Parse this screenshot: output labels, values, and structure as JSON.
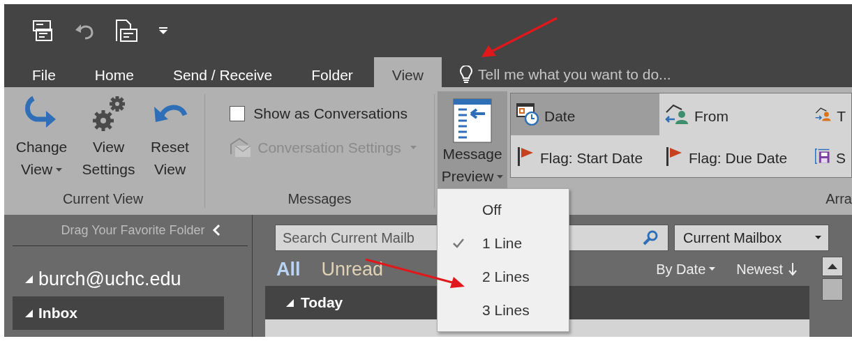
{
  "tabs": [
    {
      "label": "File",
      "selected": false
    },
    {
      "label": "Home",
      "selected": false
    },
    {
      "label": "Send / Receive",
      "selected": false
    },
    {
      "label": "Folder",
      "selected": false
    },
    {
      "label": "View",
      "selected": true
    }
  ],
  "tell_me": {
    "placeholder": "Tell me what you want to do..."
  },
  "current_view": {
    "label": "Current View",
    "buttons": [
      {
        "kind": "change",
        "label": "Change View",
        "dropdown": true
      },
      {
        "kind": "settings",
        "label": "View Settings",
        "dropdown": false
      },
      {
        "kind": "reset",
        "label": "Reset View",
        "dropdown": false
      }
    ]
  },
  "messages": {
    "label": "Messages",
    "show_as_conversations": {
      "label": "Show as Conversations",
      "checked": false
    },
    "conversation_settings": {
      "label": "Conversation Settings",
      "disabled": true
    }
  },
  "arrangement": {
    "label": "Arra",
    "preview_button": {
      "label": "Message Preview",
      "expanded": true
    },
    "items": [
      {
        "kind": "date",
        "label": "Date",
        "selected": true
      },
      {
        "kind": "from",
        "label": "From",
        "selected": false
      },
      {
        "kind": "to",
        "label": "T",
        "selected": false
      },
      {
        "kind": "flag",
        "label": "Flag: Start Date",
        "selected": false
      },
      {
        "kind": "flag",
        "label": "Flag: Due Date",
        "selected": false
      },
      {
        "kind": "size",
        "label": "S",
        "selected": false
      }
    ]
  },
  "preview_menu": [
    {
      "label": "Off",
      "checked": false
    },
    {
      "label": "1 Line",
      "checked": true
    },
    {
      "label": "2 Lines",
      "checked": false
    },
    {
      "label": "3 Lines",
      "checked": false
    }
  ],
  "nav": {
    "hint": "Drag Your Favorite Folder",
    "account": {
      "label": "burch@uchc.edu",
      "expanded": true
    },
    "folders": [
      {
        "label": "Inbox",
        "selected": true,
        "expanded": true
      }
    ]
  },
  "mail": {
    "search": {
      "placeholder": "Search Current Mailb"
    },
    "scope": "Current Mailbox",
    "filters": [
      {
        "label": "All",
        "selected": true
      },
      {
        "label": "Unread",
        "selected": false
      }
    ],
    "sort": "By Date",
    "order": "Newest",
    "groups": [
      {
        "label": "Today",
        "expanded": true
      }
    ]
  }
}
